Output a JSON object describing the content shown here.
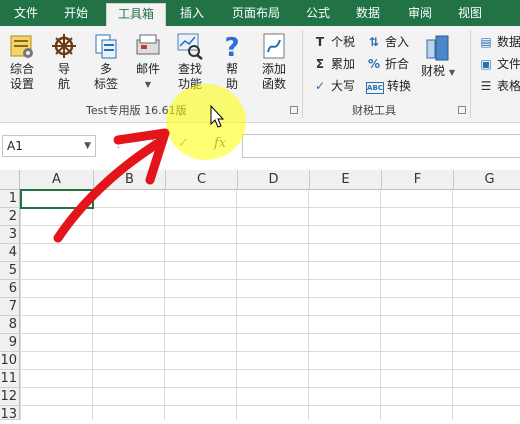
{
  "tabs": [
    "文件",
    "开始",
    "工具箱",
    "插入",
    "页面布局",
    "公式",
    "数据",
    "审阅",
    "视图"
  ],
  "ribbon": {
    "group1_buttons": [
      {
        "label": "综合\n设置",
        "icon": "settings-icon"
      },
      {
        "label": "导\n航",
        "icon": "helm-icon"
      },
      {
        "label": "多\n标签",
        "icon": "multi-tab-icon"
      },
      {
        "label": "邮件",
        "icon": "mail-icon"
      },
      {
        "label": "查找\n功能",
        "icon": "search-function-icon"
      },
      {
        "label": "帮\n助",
        "icon": "help-icon"
      },
      {
        "label": "添加\n函数",
        "icon": "add-function-icon"
      }
    ],
    "group1_label": "Test专用版 16.61版",
    "group2_rows": [
      {
        "icon": "T",
        "label": "个税"
      },
      {
        "icon": "Σ",
        "label": "累加"
      },
      {
        "icon": "✓",
        "label": "大写"
      }
    ],
    "group2_rows_b": [
      {
        "icon": "⇅",
        "label": "舍入"
      },
      {
        "icon": "%",
        "label": "折合"
      },
      {
        "icon": "ABC",
        "label": "转换"
      }
    ],
    "group2_big": "财税",
    "group2_label": "财税工具",
    "group3_rows": [
      "数据",
      "文件",
      "表格"
    ]
  },
  "formula_bar": {
    "name_box": "A1",
    "fx": "fx",
    "cancel": "✕",
    "enter": "✓"
  },
  "columns": [
    "A",
    "B",
    "C",
    "D",
    "E",
    "F",
    "G"
  ],
  "rows": [
    "1",
    "2",
    "3",
    "4",
    "5",
    "6",
    "7",
    "8",
    "9",
    "10",
    "11",
    "12",
    "13"
  ],
  "colors": {
    "accent": "#217346",
    "arrow": "#e4141b",
    "highlight": "#ffff00"
  }
}
